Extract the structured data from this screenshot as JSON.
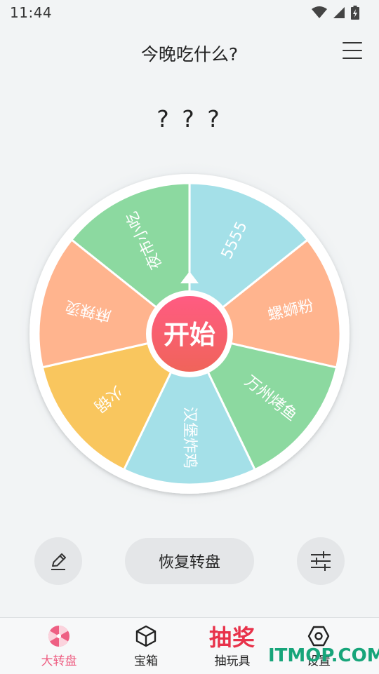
{
  "status": {
    "time": "11:44"
  },
  "header": {
    "title": "今晚吃什么?"
  },
  "result": {
    "text": "? ? ?"
  },
  "wheel": {
    "start_label": "开始",
    "segments": [
      {
        "label": "夜市小吃",
        "color": "#8cd9a0"
      },
      {
        "label": "5555",
        "color": "#a4e0e8"
      },
      {
        "label": "螺蛳粉",
        "color": "#ffb48e"
      },
      {
        "label": "万州烤鱼",
        "color": "#8cd9a0"
      },
      {
        "label": "汉堡炸鸡",
        "color": "#a4e0e8"
      },
      {
        "label": "火锅",
        "color": "#f9c65e"
      },
      {
        "label": "麻辣烫",
        "color": "#ffb48e"
      }
    ],
    "start_color_top": "#ff5b82",
    "start_color_bottom": "#f0645a"
  },
  "controls": {
    "restore_label": "恢复转盘"
  },
  "nav": {
    "items": [
      {
        "label": "大转盘"
      },
      {
        "label": "宝箱"
      },
      {
        "label": "抽玩具"
      },
      {
        "label": "设置"
      }
    ],
    "promo": "抽奖",
    "active_color": "#ee5f83"
  },
  "watermark": "ITMOP.COM"
}
